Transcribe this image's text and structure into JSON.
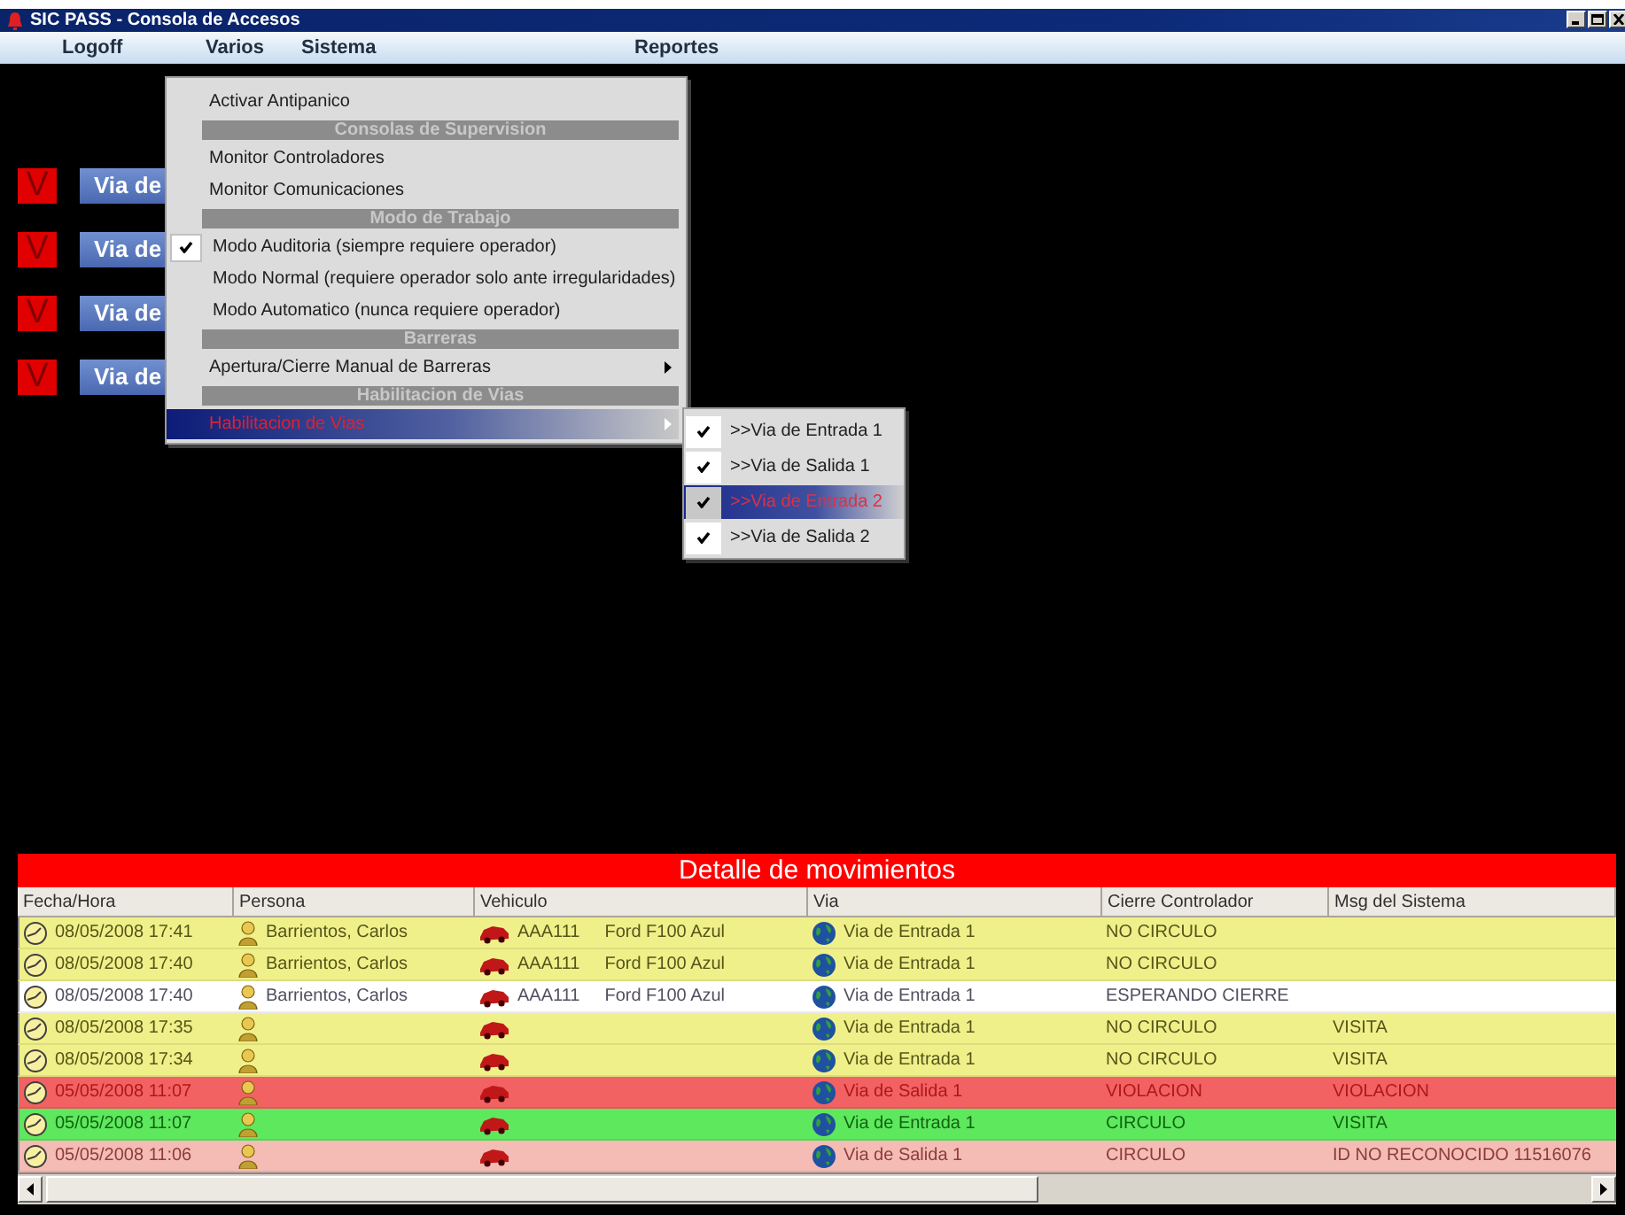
{
  "window": {
    "title": "SIC PASS - Consola de Accesos"
  },
  "menubar": [
    {
      "label": "Logoff"
    },
    {
      "label": "Varios"
    },
    {
      "label": "Sistema"
    },
    {
      "label": "Reportes"
    }
  ],
  "lanes": [
    {
      "badge": "V",
      "label": "Via de"
    },
    {
      "badge": "V",
      "label": "Via de"
    },
    {
      "badge": "V",
      "label": "Via de"
    },
    {
      "badge": "V",
      "label": "Via de"
    }
  ],
  "menu": [
    {
      "kind": "item",
      "label": "Activar Antipanico",
      "selected": false
    },
    {
      "kind": "header",
      "label": "Consolas de Supervision"
    },
    {
      "kind": "item",
      "label": "Monitor Controladores",
      "selected": false
    },
    {
      "kind": "item",
      "label": "Monitor Comunicaciones",
      "selected": false
    },
    {
      "kind": "header",
      "label": "Modo de Trabajo"
    },
    {
      "kind": "check",
      "label": "Modo Auditoria (siempre requiere operador)",
      "checked": true,
      "selected": false
    },
    {
      "kind": "check",
      "label": "Modo Normal (requiere operador solo ante irregularidades)",
      "checked": false,
      "selected": false
    },
    {
      "kind": "check",
      "label": "Modo Automatico (nunca requiere operador)",
      "checked": false,
      "selected": false
    },
    {
      "kind": "header",
      "label": "Barreras"
    },
    {
      "kind": "submenu",
      "label": "Apertura/Cierre Manual de Barreras",
      "selected": false
    },
    {
      "kind": "header",
      "label": "Habilitacion de Vias"
    },
    {
      "kind": "submenu",
      "label": "Habilitacion de Vias",
      "selected": true
    }
  ],
  "submenu": [
    {
      "label": ">>Via de Entrada 1",
      "checked": true,
      "selected": false
    },
    {
      "label": ">>Via de Salida 1",
      "checked": true,
      "selected": false
    },
    {
      "label": ">>Via de Entrada 2",
      "checked": true,
      "selected": true
    },
    {
      "label": ">>Via de Salida 2",
      "checked": true,
      "selected": false
    }
  ],
  "movements": {
    "title": "Detalle de movimientos",
    "columns": [
      "Fecha/Hora",
      "Persona",
      "Vehiculo",
      "Via",
      "Cierre Controlador",
      "Msg del Sistema"
    ],
    "rows": [
      {
        "kind": "normal",
        "datetime": "08/05/2008 17:41",
        "person": "Barrientos, Carlos",
        "plate": "AAA111",
        "model": "Ford F100 Azul",
        "lane": "Via de Entrada 1",
        "closure": "NO CIRCULO"
      },
      {
        "kind": "normal",
        "datetime": "08/05/2008 17:40",
        "person": "Barrientos, Carlos",
        "plate": "AAA111",
        "model": "Ford F100 Azul",
        "lane": "Via de Entrada 1",
        "closure": "NO CIRCULO"
      },
      {
        "kind": "pending",
        "datetime": "08/05/2008 17:40",
        "person": "Barrientos, Carlos",
        "plate": "AAA111",
        "model": "Ford F100 Azul",
        "lane": "Via de Entrada 1",
        "closure": "ESPERANDO CIERRE"
      },
      {
        "kind": "normal",
        "datetime": "08/05/2008 17:35",
        "lane": "Via de Entrada 1",
        "closure": "NO CIRCULO",
        "message": "VISITA"
      },
      {
        "kind": "normal",
        "datetime": "08/05/2008 17:34",
        "lane": "Via de Entrada 1",
        "closure": "NO CIRCULO",
        "message": "VISITA"
      },
      {
        "kind": "violation",
        "datetime": "05/05/2008 11:07",
        "lane": "Via de Salida 1",
        "closure": "VIOLACION",
        "message": "VIOLACION"
      },
      {
        "kind": "ok",
        "datetime": "05/05/2008 11:07",
        "lane": "Via de Entrada 1",
        "closure": "CIRCULO",
        "message": "VISITA"
      },
      {
        "kind": "unrecognized",
        "datetime": "05/05/2008 11:06",
        "lane": "Via de Salida 1",
        "closure": "CIRCULO",
        "message": "ID NO RECONOCIDO 11516076"
      }
    ]
  }
}
